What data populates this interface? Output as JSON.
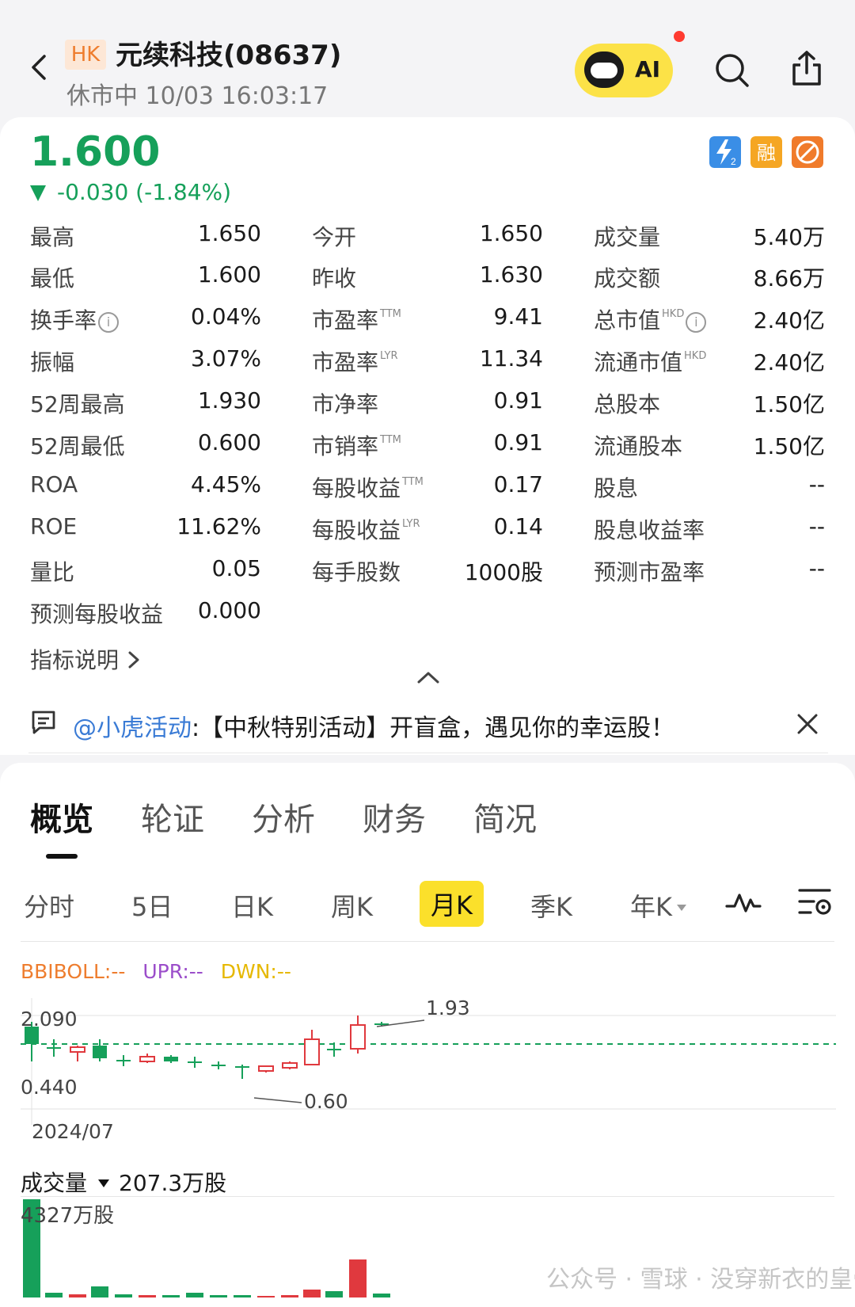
{
  "header": {
    "market_badge": "HK",
    "title": "元续科技(08637)",
    "status": "休市中 10/03 16:03:17",
    "ai_label": "AI"
  },
  "quote": {
    "price": "1.600",
    "change": "-0.030 (-1.84%)",
    "color_down": "#16a05a"
  },
  "stats": {
    "col1": [
      {
        "label": "最高",
        "value": "1.650"
      },
      {
        "label": "最低",
        "value": "1.600"
      },
      {
        "label": "换手率",
        "value": "0.04%"
      },
      {
        "label": "振幅",
        "value": "3.07%"
      },
      {
        "label": "52周最高",
        "value": "1.930"
      },
      {
        "label": "52周最低",
        "value": "0.600"
      },
      {
        "label": "ROA",
        "value": "4.45%"
      },
      {
        "label": "ROE",
        "value": "11.62%"
      },
      {
        "label": "量比",
        "value": "0.05"
      },
      {
        "label": "预测每股收益",
        "value": "0.000"
      }
    ],
    "col2": [
      {
        "label": "今开",
        "sup": "",
        "value": "1.650"
      },
      {
        "label": "昨收",
        "sup": "",
        "value": "1.630"
      },
      {
        "label": "市盈率",
        "sup": "TTM",
        "value": "9.41"
      },
      {
        "label": "市盈率",
        "sup": "LYR",
        "value": "11.34"
      },
      {
        "label": "市净率",
        "sup": "",
        "value": "0.91"
      },
      {
        "label": "市销率",
        "sup": "TTM",
        "value": "0.91"
      },
      {
        "label": "每股收益",
        "sup": "TTM",
        "value": "0.17"
      },
      {
        "label": "每股收益",
        "sup": "LYR",
        "value": "0.14"
      },
      {
        "label": "每手股数",
        "sup": "",
        "value": "1000股"
      }
    ],
    "col3": [
      {
        "label": "成交量",
        "sup": "",
        "value": "5.40万"
      },
      {
        "label": "成交额",
        "sup": "",
        "value": "8.66万"
      },
      {
        "label": "总市值",
        "sup": "HKD",
        "value": "2.40亿"
      },
      {
        "label": "流通市值",
        "sup": "HKD",
        "value": "2.40亿"
      },
      {
        "label": "总股本",
        "sup": "",
        "value": "1.50亿"
      },
      {
        "label": "流通股本",
        "sup": "",
        "value": "1.50亿"
      },
      {
        "label": "股息",
        "sup": "",
        "value": "--"
      },
      {
        "label": "股息收益率",
        "sup": "",
        "value": "--"
      },
      {
        "label": "预测市盈率",
        "sup": "",
        "value": "--"
      }
    ]
  },
  "indicator_link": "指标说明",
  "notice": {
    "mention": "@小虎活动",
    "text": ":【中秋特别活动】开盲盒，遇见你的幸运股！"
  },
  "tabs": [
    "概览",
    "轮证",
    "分析",
    "财务",
    "简况"
  ],
  "periods": [
    "分时",
    "5日",
    "日K",
    "周K",
    "月K",
    "季K",
    "年K"
  ],
  "active_period": "月K",
  "chart": {
    "boll": {
      "bbiboll": "BBIBOLL:--",
      "upr": "UPR:--",
      "dwn": "DWN:--"
    },
    "y_top": "2.090",
    "y_bottom": "0.440",
    "x_start": "2024/07",
    "high_label": "1.93",
    "low_label": "0.60",
    "volume_label": "成交量",
    "volume_value": "207.3万股",
    "volume_max": "4327万股",
    "colors": {
      "up": "#e0393e",
      "down": "#16a05a",
      "boll": "#ee7d2e",
      "upr": "#9b4dca",
      "dwn": "#e6b800"
    }
  },
  "watermark": "公众号 · 雪球 · 没穿新衣的皇帝"
}
